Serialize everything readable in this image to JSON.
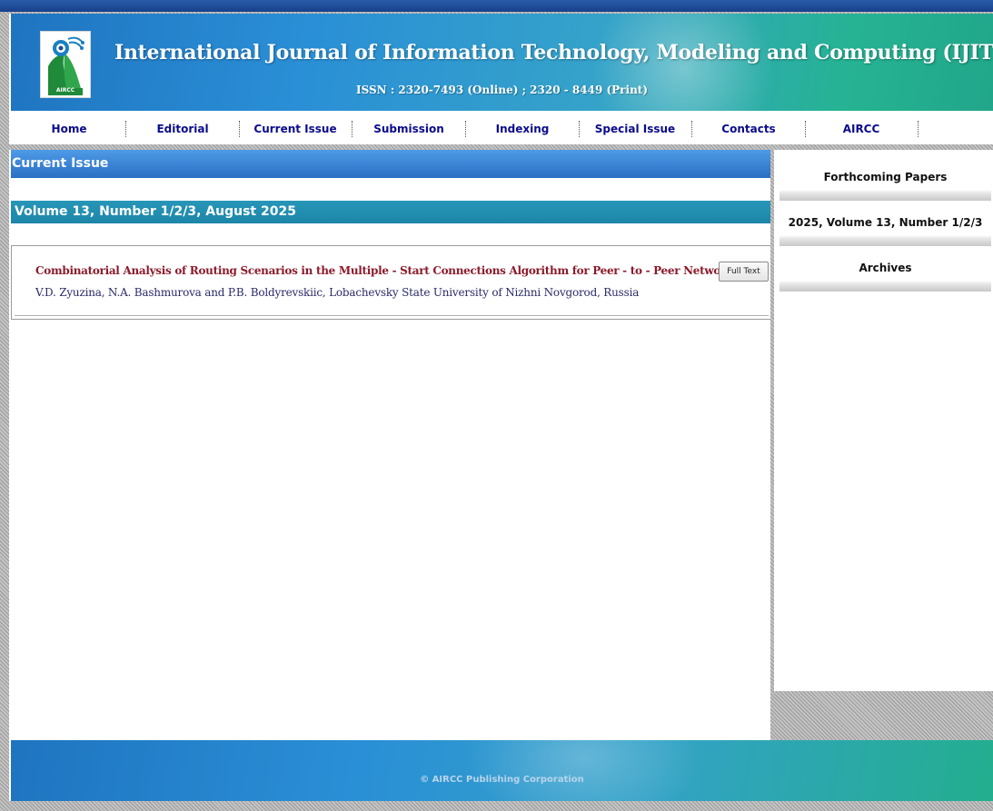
{
  "header": {
    "logo_text": "AIRCC",
    "title": "International Journal of Information Technology, Modeling and Computing (IJITMC)",
    "issn": "ISSN : 2320-7493 (Online) ; 2320 - 8449 (Print)"
  },
  "nav": {
    "items": [
      "Home",
      "Editorial",
      "Current Issue",
      "Submission",
      "Indexing",
      "Special Issue",
      "Contacts",
      "AIRCC"
    ]
  },
  "main": {
    "section_title": "Current Issue",
    "volume_title": "Volume 13, Number 1/2/3, August 2025",
    "papers": [
      {
        "title": "Combinatorial Analysis of Routing Scenarios in the Multiple - Start Connections Algorithm for Peer - to - Peer Networks",
        "authors": "V.D. Zyuzina, N.A. Bashmurova and P.B. Boldyrevskiic, Lobachevsky State University of Nizhni Novgorod, Russia",
        "button_label": "Full Text"
      }
    ]
  },
  "sidebar": {
    "items": [
      "Forthcoming Papers",
      "2025, Volume 13, Number 1/2/3",
      "Archives"
    ]
  },
  "footer": {
    "copyright": "© AIRCC Publishing Corporation"
  },
  "colors": {
    "header_blue": "#1f74c0",
    "header_teal": "#21a68a",
    "nav_link": "#0b0b8c",
    "section_bar": "#2a6fc4",
    "volume_bar": "#1d86a8",
    "paper_title": "#8b1a2b",
    "paper_authors": "#2a2a6a"
  },
  "icons": {
    "logo": "peacock-logo-icon"
  }
}
